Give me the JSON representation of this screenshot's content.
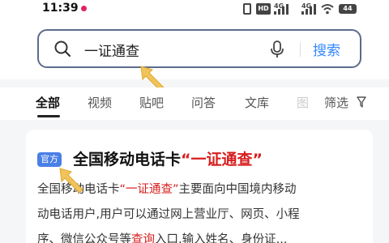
{
  "status_bar": {
    "time": "11:39",
    "hd_label": "HD",
    "net1_label": "4G",
    "net2_label": "4G",
    "battery": "44",
    "notification_color": "#e0245e"
  },
  "search": {
    "value": "一证通查",
    "button_label": "搜索",
    "accent": "#3388ff"
  },
  "tabs": {
    "items": [
      {
        "label": "全部",
        "active": true
      },
      {
        "label": "视频"
      },
      {
        "label": "贴吧"
      },
      {
        "label": "问答"
      },
      {
        "label": "文库"
      },
      {
        "label": "图"
      }
    ],
    "filter_label": "筛选"
  },
  "result": {
    "badge": "官方",
    "title_prefix": "全国移动电话卡",
    "title_highlight": "“一证通查”",
    "line1_prefix": "全国移动电话卡",
    "line1_highlight": "“一证通查”",
    "line1_suffix": "主要面向中国境内移动",
    "line2": "动电话用户,用户可以通过网上营业厅、网页、小程",
    "line3_prefix": "序、微信公众号等",
    "line3_highlight": "查询",
    "line3_suffix": "入口,输入姓名、身份证...",
    "highlight_color": "#d81e1e",
    "badge_color": "#4a7fe6"
  }
}
